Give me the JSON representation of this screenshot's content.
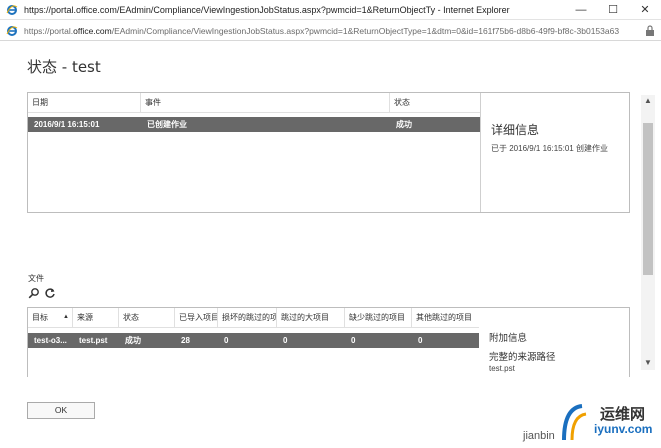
{
  "window": {
    "title": "https://portal.office.com/EAdmin/Compliance/ViewIngestionJobStatus.aspx?pwmcid=1&ReturnObjectTy - Internet Explorer",
    "minimize_glyph": "—",
    "maximize_glyph": "☐",
    "close_glyph": "✕"
  },
  "address": {
    "url_prefix": "https://portal.",
    "url_domain": "office.com",
    "url_rest": "/EAdmin/Compliance/ViewIngestionJobStatus.aspx?pwmcid=1&ReturnObjectType=1&dtm=0&id=161f75b6-d8b6-49f9-bf8c-3b0153a63"
  },
  "page": {
    "title": "状态 - test"
  },
  "events": {
    "columns": [
      "日期",
      "事件",
      "状态"
    ],
    "rows": [
      {
        "date": "2016/9/1 16:15:01",
        "event": "已创建作业",
        "status": "成功"
      }
    ]
  },
  "details": {
    "title": "详细信息",
    "text": "已于 2016/9/1 16:15:01 创建作业"
  },
  "files": {
    "label": "文件",
    "columns": [
      "目标",
      "来源",
      "状态",
      "已导入项目",
      "损坏的跳过的项",
      "跳过的大项目",
      "缺少跳过的项目",
      "其他跳过的项目"
    ],
    "rows": [
      {
        "target": "test-o3...",
        "source": "test.pst",
        "status": "成功",
        "imported": "28",
        "corrupt": "0",
        "large": "0",
        "missing": "0",
        "other": "0"
      }
    ]
  },
  "file_details": {
    "title": "附加信息",
    "subtitle": "完整的来源路径",
    "path": "test.pst"
  },
  "buttons": {
    "ok": "OK"
  },
  "watermark": {
    "cn": "运维网",
    "site": "iyunv.com",
    "user": "jianbin"
  },
  "colors": {
    "selected_row": "#686868",
    "ie_blue": "#1e73be"
  },
  "icons": [
    "internet-explorer-icon",
    "lock-icon",
    "search-icon",
    "refresh-icon",
    "sort-asc-icon"
  ]
}
